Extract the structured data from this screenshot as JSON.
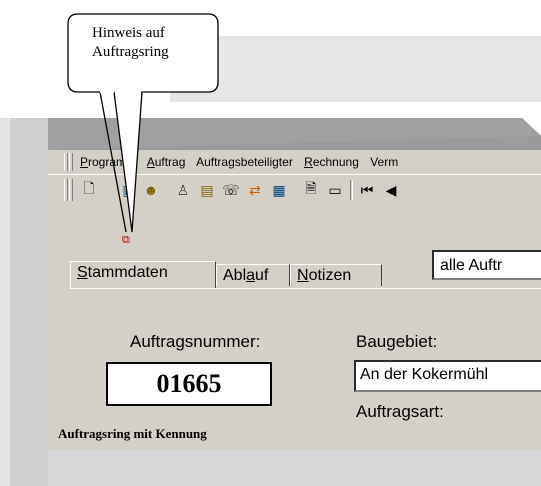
{
  "callout": {
    "line1": "Hinweis auf",
    "line2": "Auftragsring"
  },
  "menu": {
    "items": [
      {
        "pre": "",
        "ul": "P",
        "post": "rogramm"
      },
      {
        "pre": "",
        "ul": "A",
        "post": "uftrag"
      },
      {
        "pre": "Auftra",
        "ul": "g",
        "post": "sbeteiligter"
      },
      {
        "pre": "",
        "ul": "R",
        "post": "echnung"
      },
      {
        "pre": "Verm",
        "ul": "",
        "post": ""
      }
    ]
  },
  "toolbar": {
    "icons": [
      "new-document-icon",
      "open-book-icon",
      "persons-icon",
      "person-icon",
      "card-icon",
      "telephone-icon",
      "exchange-icon",
      "notes-icon",
      "document-new-icon",
      "document-icon",
      "first-record-icon",
      "previous-record-icon"
    ]
  },
  "tabs": {
    "stammdaten": {
      "ul": "S",
      "rest": "tammdaten"
    },
    "ablauf": {
      "pre": "Abl",
      "ul": "a",
      "post": "uf"
    },
    "notizen": {
      "ul": "N",
      "rest": "otizen"
    }
  },
  "filter": {
    "value": "alle Auftr"
  },
  "form": {
    "order_label": "Auftragsnummer:",
    "order_number": "01665",
    "area_label": "Baugebiet:",
    "area_value": "An der Kokermühl",
    "type_label": "Auftragsart:"
  },
  "caption": "Auftragsring mit Kennung"
}
